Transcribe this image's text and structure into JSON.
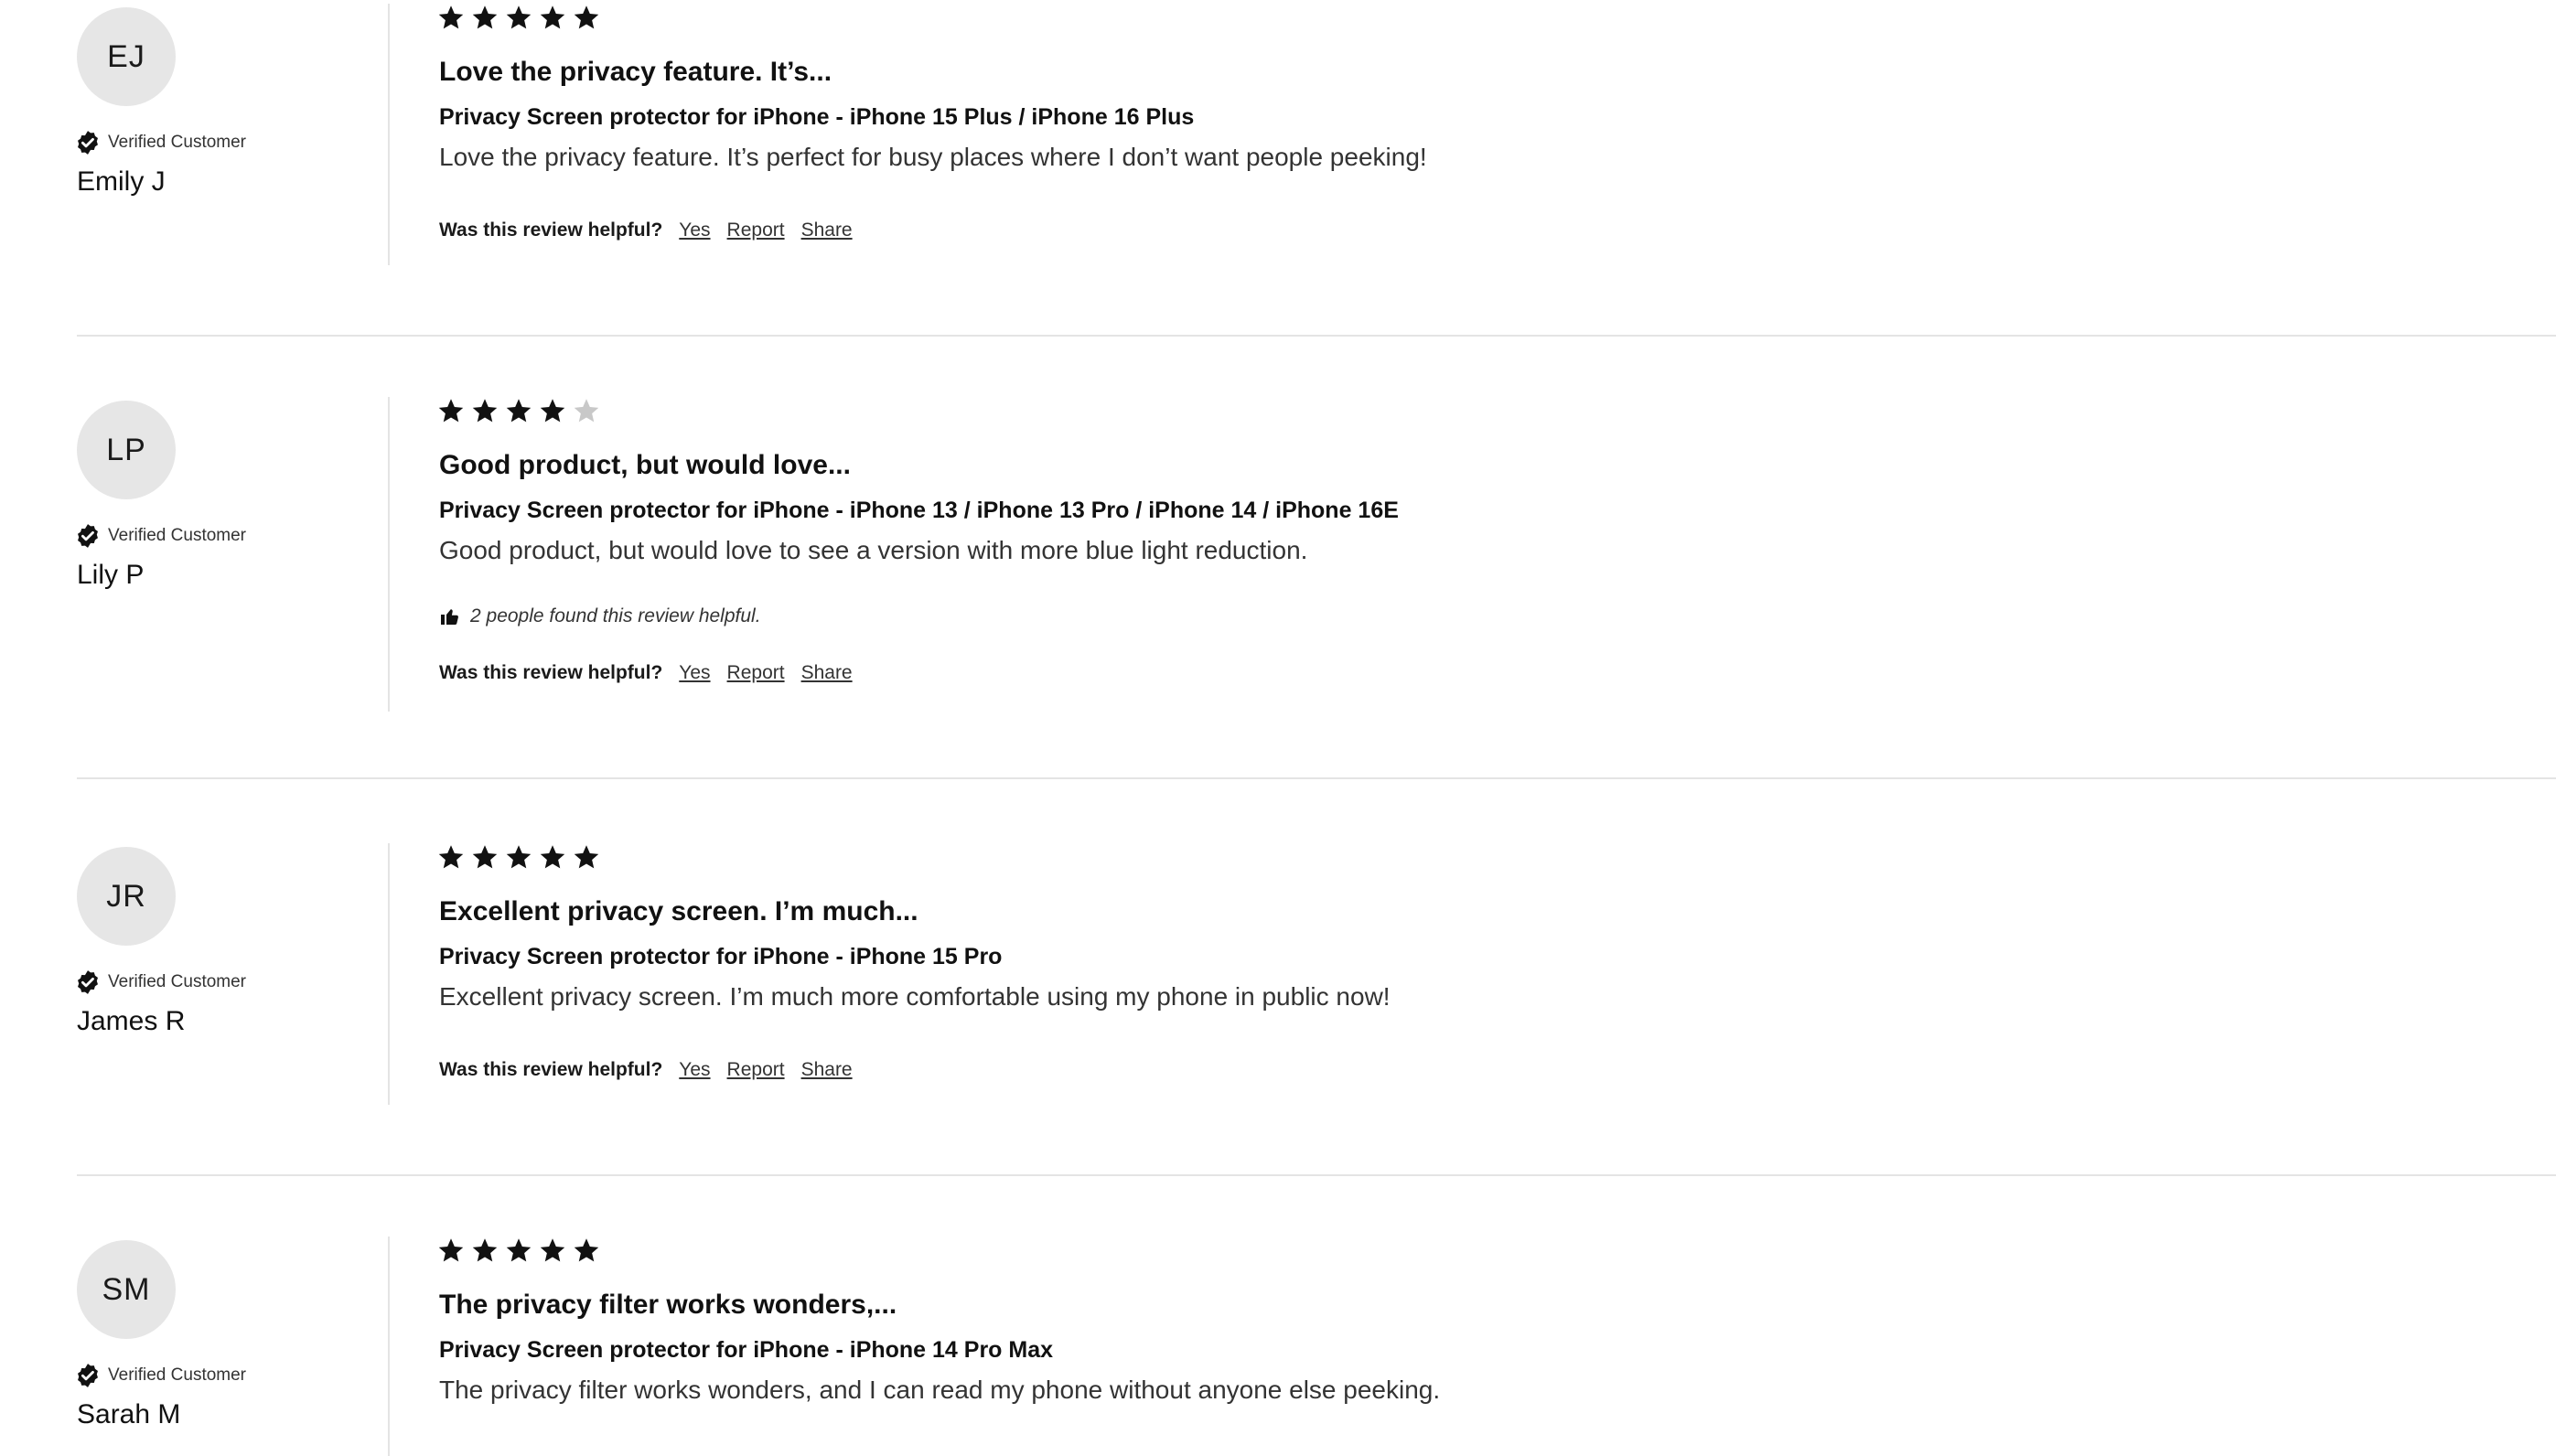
{
  "verified_label": "Verified Customer",
  "helpful_question": "Was this review helpful?",
  "action_yes": "Yes",
  "action_report": "Report",
  "action_share": "Share",
  "colors": {
    "star_filled": "#111111",
    "star_empty": "#c8c8c8",
    "avatar_bg": "#e6e6e6",
    "divider": "#e4e4e4"
  },
  "reviews": [
    {
      "initials": "EJ",
      "name": "Emily J",
      "rating": 5,
      "title": "Love the privacy feature. It’s...",
      "product": "Privacy Screen protector for iPhone - iPhone 15 Plus / iPhone 16 Plus",
      "body": "Love the privacy feature. It’s perfect for busy places where I don’t want people peeking!",
      "helpful_text": ""
    },
    {
      "initials": "LP",
      "name": "Lily P",
      "rating": 4,
      "title": "Good product, but would love...",
      "product": "Privacy Screen protector for iPhone - iPhone 13 / iPhone 13 Pro / iPhone 14 / iPhone 16E",
      "body": "Good product, but would love to see a version with more blue light reduction.",
      "helpful_text": "2 people found this review helpful."
    },
    {
      "initials": "JR",
      "name": "James R",
      "rating": 5,
      "title": "Excellent privacy screen. I’m much...",
      "product": "Privacy Screen protector for iPhone - iPhone 15 Pro",
      "body": "Excellent privacy screen. I’m much more comfortable using my phone in public now!",
      "helpful_text": ""
    },
    {
      "initials": "SM",
      "name": "Sarah M",
      "rating": 5,
      "title": "The privacy filter works wonders,...",
      "product": "Privacy Screen protector for iPhone - iPhone 14 Pro Max",
      "body": "The privacy filter works wonders, and I can read my phone without anyone else peeking.",
      "helpful_text": ""
    }
  ]
}
